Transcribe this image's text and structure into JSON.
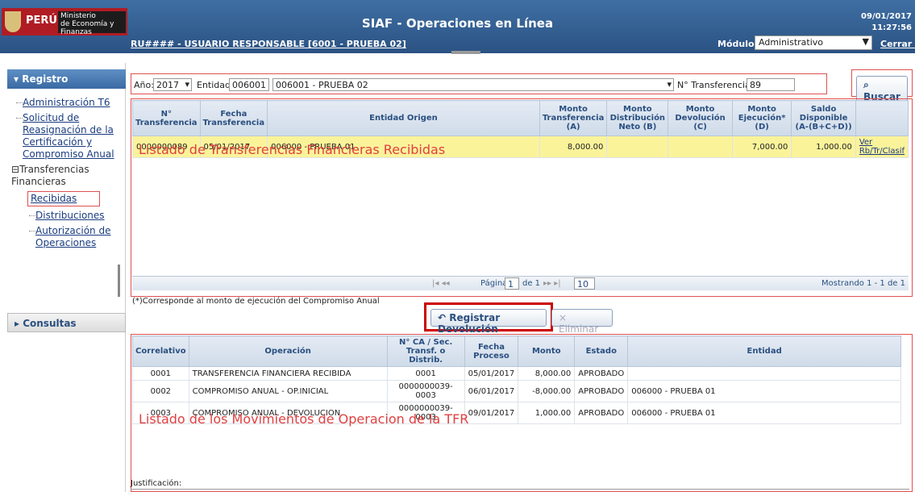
{
  "header": {
    "logo_country": "PERÚ",
    "logo_ministry_line1": "Ministerio",
    "logo_ministry_line2": "de Economía y Finanzas",
    "title": "SIAF - Operaciones en Línea",
    "date": "09/01/2017",
    "time": "11:27:56",
    "user": "RU#### - USUARIO RESPONSABLE [6001 - PRUEBA 02]",
    "module_label": "Módulo:",
    "module_value": "Administrativo",
    "logout": "Cerrar sesión"
  },
  "sidebar": {
    "registro": "Registro",
    "consultas": "Consultas",
    "items": [
      {
        "label": "Administración T6"
      },
      {
        "label": "Solicitud de Reasignación de la Certificación y Compromiso Anual"
      },
      {
        "label": "Transferencias Financieras"
      },
      {
        "label": "Recibidas"
      },
      {
        "label": "Distribuciones"
      },
      {
        "label": "Autorización de Operaciones"
      }
    ]
  },
  "filters": {
    "anio_label": "Año:",
    "anio_value": "2017",
    "entidad_label": "Entidad:",
    "entidad_code": "006001",
    "entidad_name": "006001 - PRUEBA 02",
    "transf_label": "N° Transferencia:",
    "transf_value": "89",
    "search_button": "Buscar"
  },
  "transfers": {
    "headers": [
      "N° Transferencia",
      "Fecha Transferencia",
      "Entidad Origen",
      "Monto Transferencia (A)",
      "Monto Distribución Neto (B)",
      "Monto Devolución (C)",
      "Monto Ejecución* (D)",
      "Saldo Disponible (A-(B+C+D))"
    ],
    "rows": [
      {
        "num": "0000000089",
        "fecha": "05/01/2017",
        "entidad": "006000 - PRUEBA 01",
        "monto": "8,000.00",
        "dist": "",
        "dev": "",
        "ejec": "7,000.00",
        "saldo": "1,000.00",
        "link": "Ver Rb/Tr/Clasif"
      }
    ],
    "annotation": "Listado de Transferencias Financieras Recibidas",
    "pager_page": "Página",
    "pager_value": "1",
    "pager_of": "de 1",
    "pager_size": "10",
    "pager_info": "Mostrando 1 - 1 de 1",
    "footnote": "(*)Corresponde al monto de ejecución del Compromiso Anual"
  },
  "actions": {
    "register": "Registrar Devolución",
    "delete": "Eliminar"
  },
  "movements": {
    "headers": [
      "Correlativo",
      "Operación",
      "N° CA / Sec. Transf. o Distrib.",
      "Fecha Proceso",
      "Monto",
      "Estado",
      "Entidad"
    ],
    "rows": [
      {
        "corr": "0001",
        "op": "TRANSFERENCIA FINANCIERA RECIBIDA",
        "ca": "0001",
        "fecha": "05/01/2017",
        "monto": "8,000.00",
        "estado": "APROBADO",
        "entidad": ""
      },
      {
        "corr": "0002",
        "op": "COMPROMISO ANUAL - OP.INICIAL",
        "ca": "0000000039-0003",
        "fecha": "06/01/2017",
        "monto": "-8,000.00",
        "estado": "APROBADO",
        "entidad": "006000 - PRUEBA 01"
      },
      {
        "corr": "0003",
        "op": "COMPROMISO ANUAL - DEVOLUCION",
        "ca": "0000000039-0003",
        "fecha": "09/01/2017",
        "monto": "1,000.00",
        "estado": "APROBADO",
        "entidad": "006000 - PRUEBA 01"
      }
    ],
    "annotation": "Listado de los Movimientos de Operacion de la TFR",
    "justificacion": "Justificación:"
  }
}
